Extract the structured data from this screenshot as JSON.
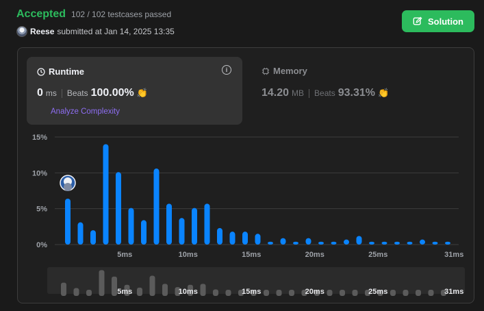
{
  "submission": {
    "status": "Accepted",
    "testcases": "102 / 102 testcases passed",
    "user": "Reese",
    "submitted_text": "submitted at Jan 14, 2025 13:35"
  },
  "solution_button": {
    "label": "Solution"
  },
  "runtime": {
    "title": "Runtime",
    "value": "0",
    "unit": "ms",
    "beats_label": "Beats",
    "beats": "100.00%",
    "analyze": "Analyze Complexity"
  },
  "memory": {
    "title": "Memory",
    "value": "14.20",
    "unit": "MB",
    "beats_label": "Beats",
    "beats": "93.31%"
  },
  "chart_data": {
    "type": "bar",
    "y_ticks": [
      "15%",
      "10%",
      "5%",
      "0%"
    ],
    "ylim": [
      0,
      15
    ],
    "x_ticks": [
      "5ms",
      "10ms",
      "15ms",
      "20ms",
      "25ms",
      "31ms"
    ],
    "x_tick_positions": [
      5,
      10,
      15,
      20,
      25,
      31
    ],
    "x": [
      0,
      1,
      2,
      3,
      4,
      5,
      6,
      7,
      8,
      9,
      10,
      11,
      12,
      13,
      14,
      15,
      16,
      17,
      18,
      19,
      20,
      21,
      22,
      23,
      24,
      25,
      26,
      27,
      28,
      29,
      30
    ],
    "values": [
      6.4,
      3.1,
      2.0,
      14.0,
      10.1,
      5.1,
      3.4,
      10.6,
      5.7,
      3.7,
      5.1,
      5.7,
      2.3,
      1.8,
      1.8,
      1.5,
      0.4,
      0.9,
      0.4,
      0.9,
      0.4,
      0.4,
      0.7,
      1.2,
      0.4,
      0.4,
      0.4,
      0.4,
      0.7,
      0.4,
      0.4
    ],
    "highlight_index": 0,
    "colors": {
      "bar": "#0a84ff",
      "overview_bar": "#5b5b5b",
      "grid": "#3e3e3e"
    }
  }
}
